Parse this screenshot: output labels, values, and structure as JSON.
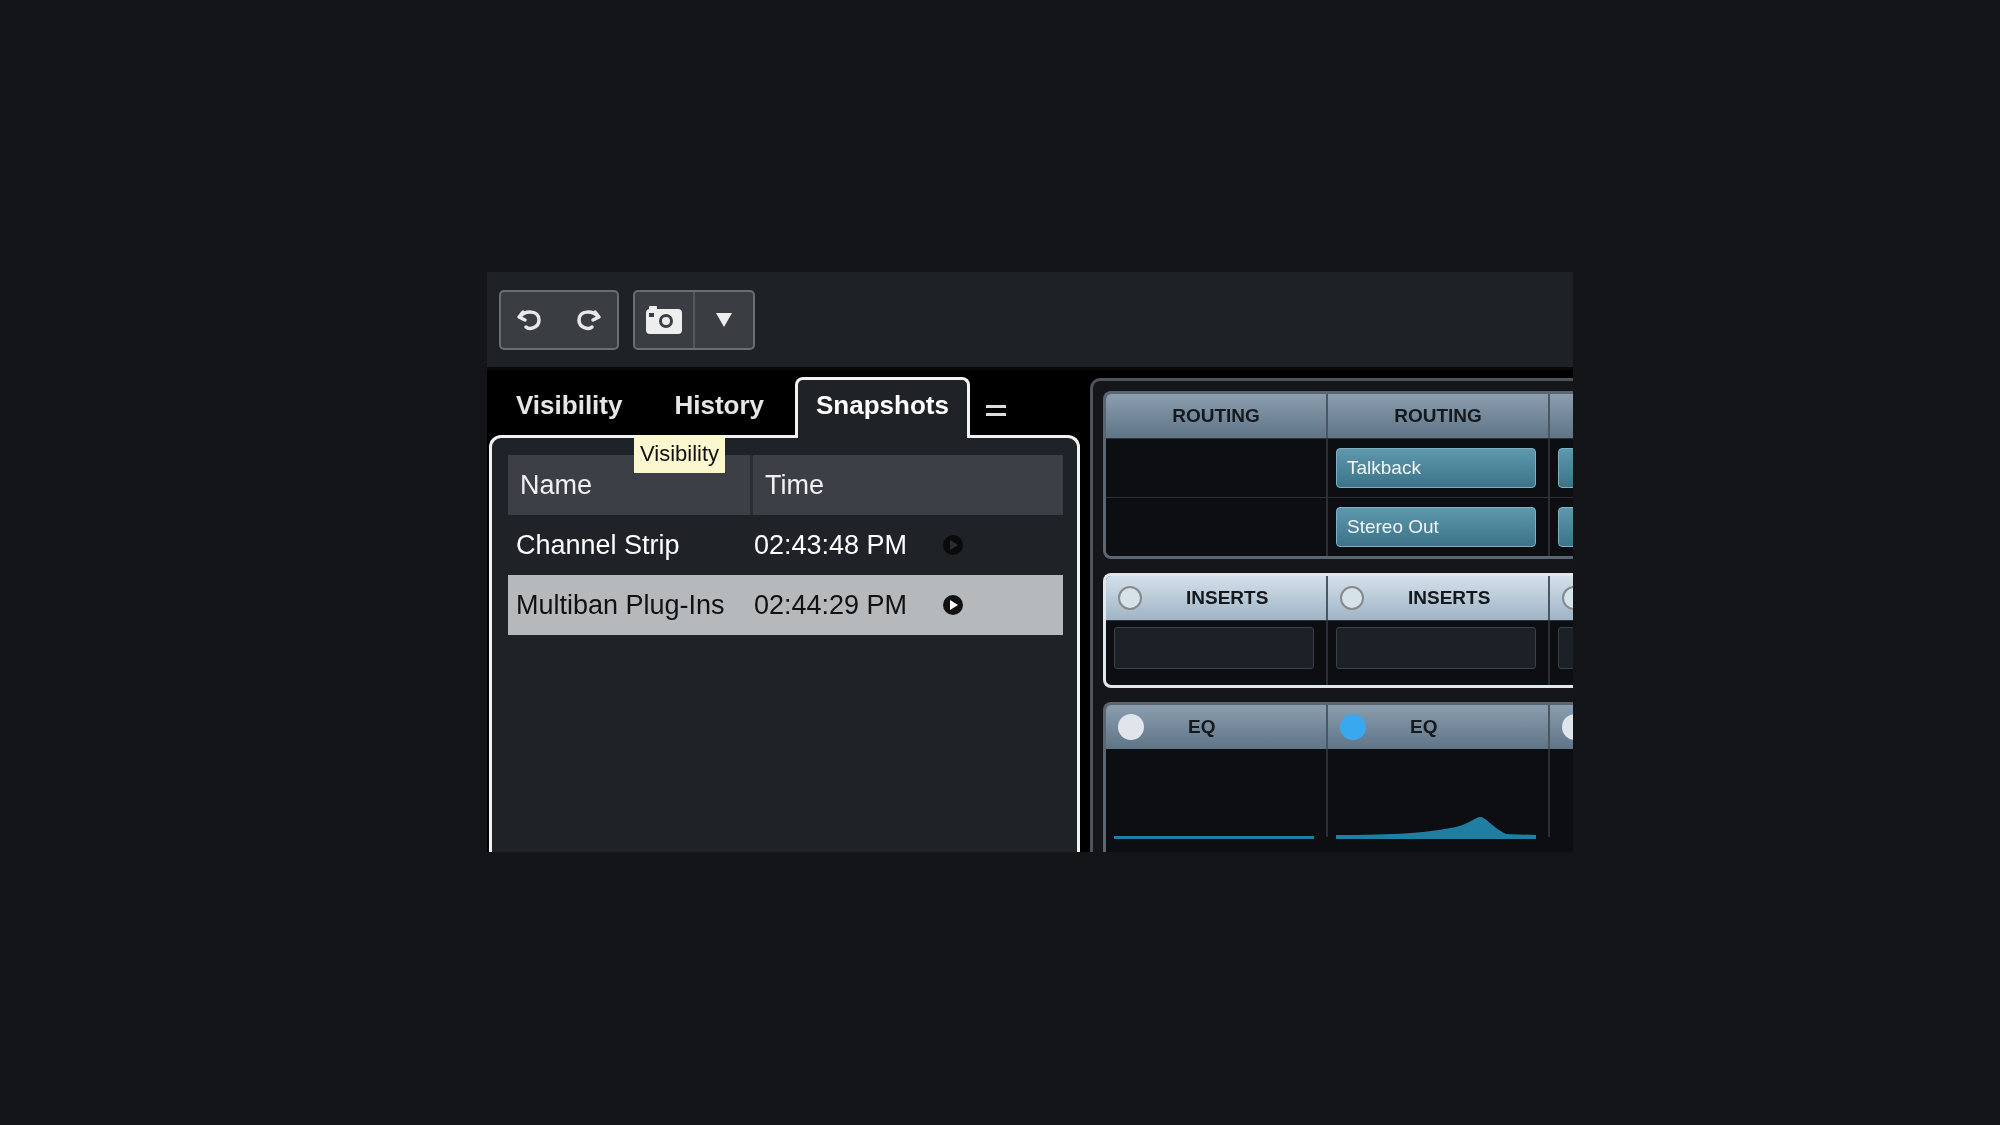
{
  "tabs": [
    {
      "label": "Visibility",
      "selected": false
    },
    {
      "label": "History",
      "selected": false
    },
    {
      "label": "Snapshots",
      "selected": true
    }
  ],
  "tooltip": {
    "text": "Visibility"
  },
  "table": {
    "columns": [
      "Name",
      "Time"
    ],
    "rows": [
      {
        "name": "Channel Strip",
        "time": "02:43:48 PM",
        "selected": false
      },
      {
        "name": "Multiban Plug-Ins",
        "time": "02:44:29 PM",
        "selected": true
      }
    ]
  },
  "channels": [
    {
      "routing": "ROUTING",
      "inserts": "INSERTS",
      "inserts_on": false,
      "eq": "EQ",
      "eq_on": false,
      "eq_peak": false
    },
    {
      "routing": "ROUTING",
      "routing_slots": [
        "Talkback",
        "Stereo Out"
      ],
      "inserts": "INSERTS",
      "inserts_on": false,
      "eq": "EQ",
      "eq_on": true,
      "eq_peak": true
    }
  ]
}
